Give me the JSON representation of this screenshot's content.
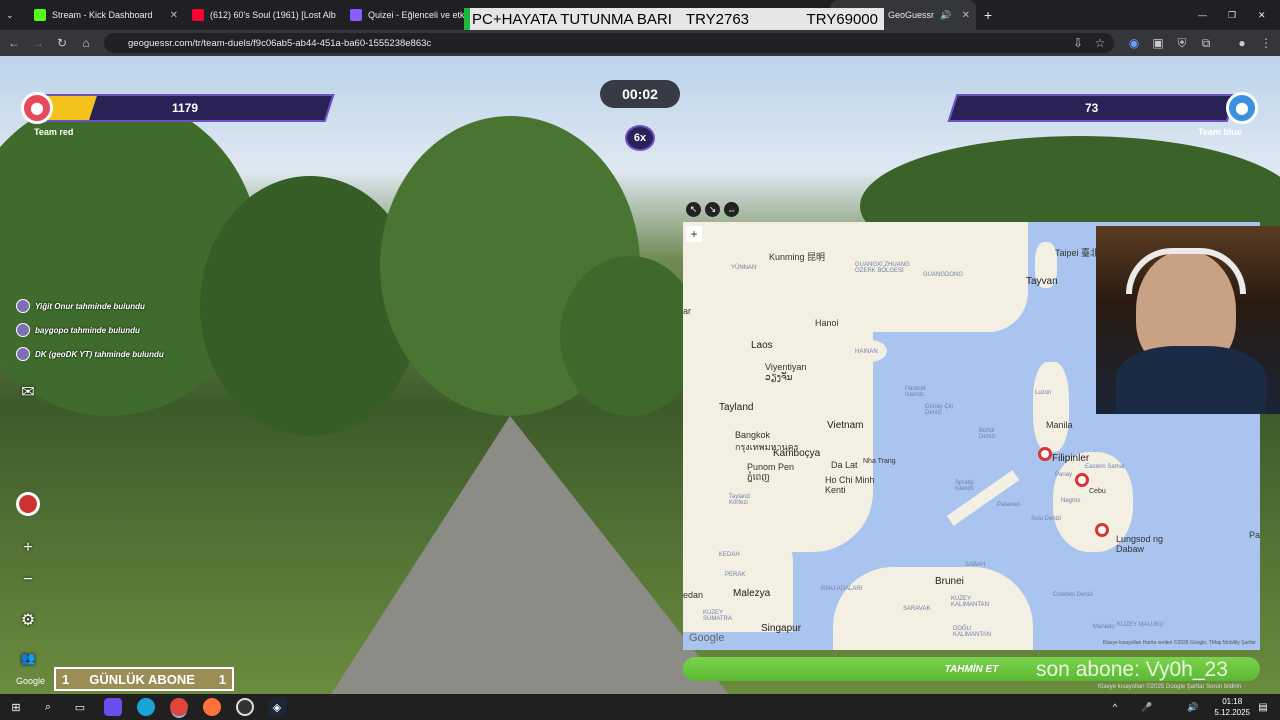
{
  "tabs": [
    {
      "title": "Stream - Kick Dashboard",
      "color": "#53fc18"
    },
    {
      "title": "(612) 60's Soul (1961) [Lost Alb",
      "color": "#ff0033"
    },
    {
      "title": "Quizei - Eğlenceli ve etkileş",
      "color": "#8a5cff"
    },
    {
      "title": "GeoGuessr",
      "color": "#1b1b4f"
    }
  ],
  "address": {
    "url": "geoguessr.com/tr/team-duels/f9c06ab5-ab44-451a-ba60-1555238e863c"
  },
  "overlay": {
    "tts_left": "PC+HAYATA TUTUNMA BARI",
    "tts_mid": "TRY2763",
    "tts_right": "TRY69000"
  },
  "game": {
    "red": {
      "score": "1179",
      "label": "Team red",
      "health": 0.18
    },
    "blue": {
      "score": "73",
      "label": "Team blue"
    },
    "timer": "00:02",
    "multiplier": "6x",
    "guesses": [
      "Yiğit Onur tahminde bulundu",
      "baygopo tahminde bulundu",
      "DK (geoDK YT) tahminde bulundu"
    ],
    "guess_button": "TAHMİN ET",
    "google": "Google"
  },
  "map": {
    "labels": {
      "kunming": "Kunming 昆明",
      "yunnan": "YÜNNAN",
      "guangxi": "GUANGXI ZHUANG ÖZERK BÖLGESİ",
      "guangdong": "GUANGDONG",
      "taipei": "Taipei 臺北",
      "tayvan": "Tayvan",
      "hanoi": "Hanoi",
      "hainan": "HAINAN",
      "laos": "Laos",
      "viyentiyan": "Viyentiyan ວຽງຈັນ",
      "tayland": "Tayland",
      "vietnam": "Vietnam",
      "bangkok": "Bangkok กรุงเทพมหานคร",
      "kambocya": "Kamboçya",
      "punompen": "Punom Pen ភ្នំពេញ",
      "dalat": "Da Lat",
      "nhatrang": "Nha Trang",
      "hcm": "Ho Chi Minh Kenti",
      "manila": "Manila",
      "filipinler": "Filipinler",
      "cebu": "Cebu",
      "lungsod": "Lungsod ng Dabaw",
      "palau": "Palau",
      "brunei": "Brunei",
      "malezya": "Malezya",
      "singapur": "Singapur",
      "sabah": "SABAH",
      "sarawak": "SARAVAK",
      "kalimantan": "KUZEY KALIMANTAN",
      "kedah": "KEDAH",
      "perak": "PERAK",
      "riau": "RİAU ADALARI",
      "paracel": "Paracel Islands",
      "spratly": "Spratly Islands",
      "gcd": "Güney Çin Denizi",
      "sulu": "Sulu Denizi",
      "celebes": "Celebes Denizi",
      "tayland_korfezi": "Tayland Körfezi",
      "bohol": "Bohol Denizi",
      "luzon": "Luzon",
      "palawan": "Palawan",
      "negros": "Negros",
      "samar": "Eastern Samar",
      "panay": "Panay",
      "manado": "Manado",
      "kuzey_maluku": "KUZEY MALUKU",
      "dogu_kalimantan": "DOĞU KALIMANTAN",
      "kuzey_sumatra": "KUZEY SUMATRA",
      "medan": "edan",
      "ar": "ar",
      "attribution": "Klavye kısayolları   Harita verileri ©2025 Google, TMap Mobility   Şartlar",
      "google": "Google"
    }
  },
  "stream": {
    "subs_count": "1",
    "subs_label": "GÜNLÜK ABONE",
    "subs_goal": "1",
    "last_sub": "son abone: Vy0h_23"
  },
  "footer": {
    "links": "Klavye kısayolları  ©2025 Google  Şartlar  Sorun bildirin"
  },
  "clock": {
    "time": "01:18",
    "date": "5.12.2025"
  }
}
